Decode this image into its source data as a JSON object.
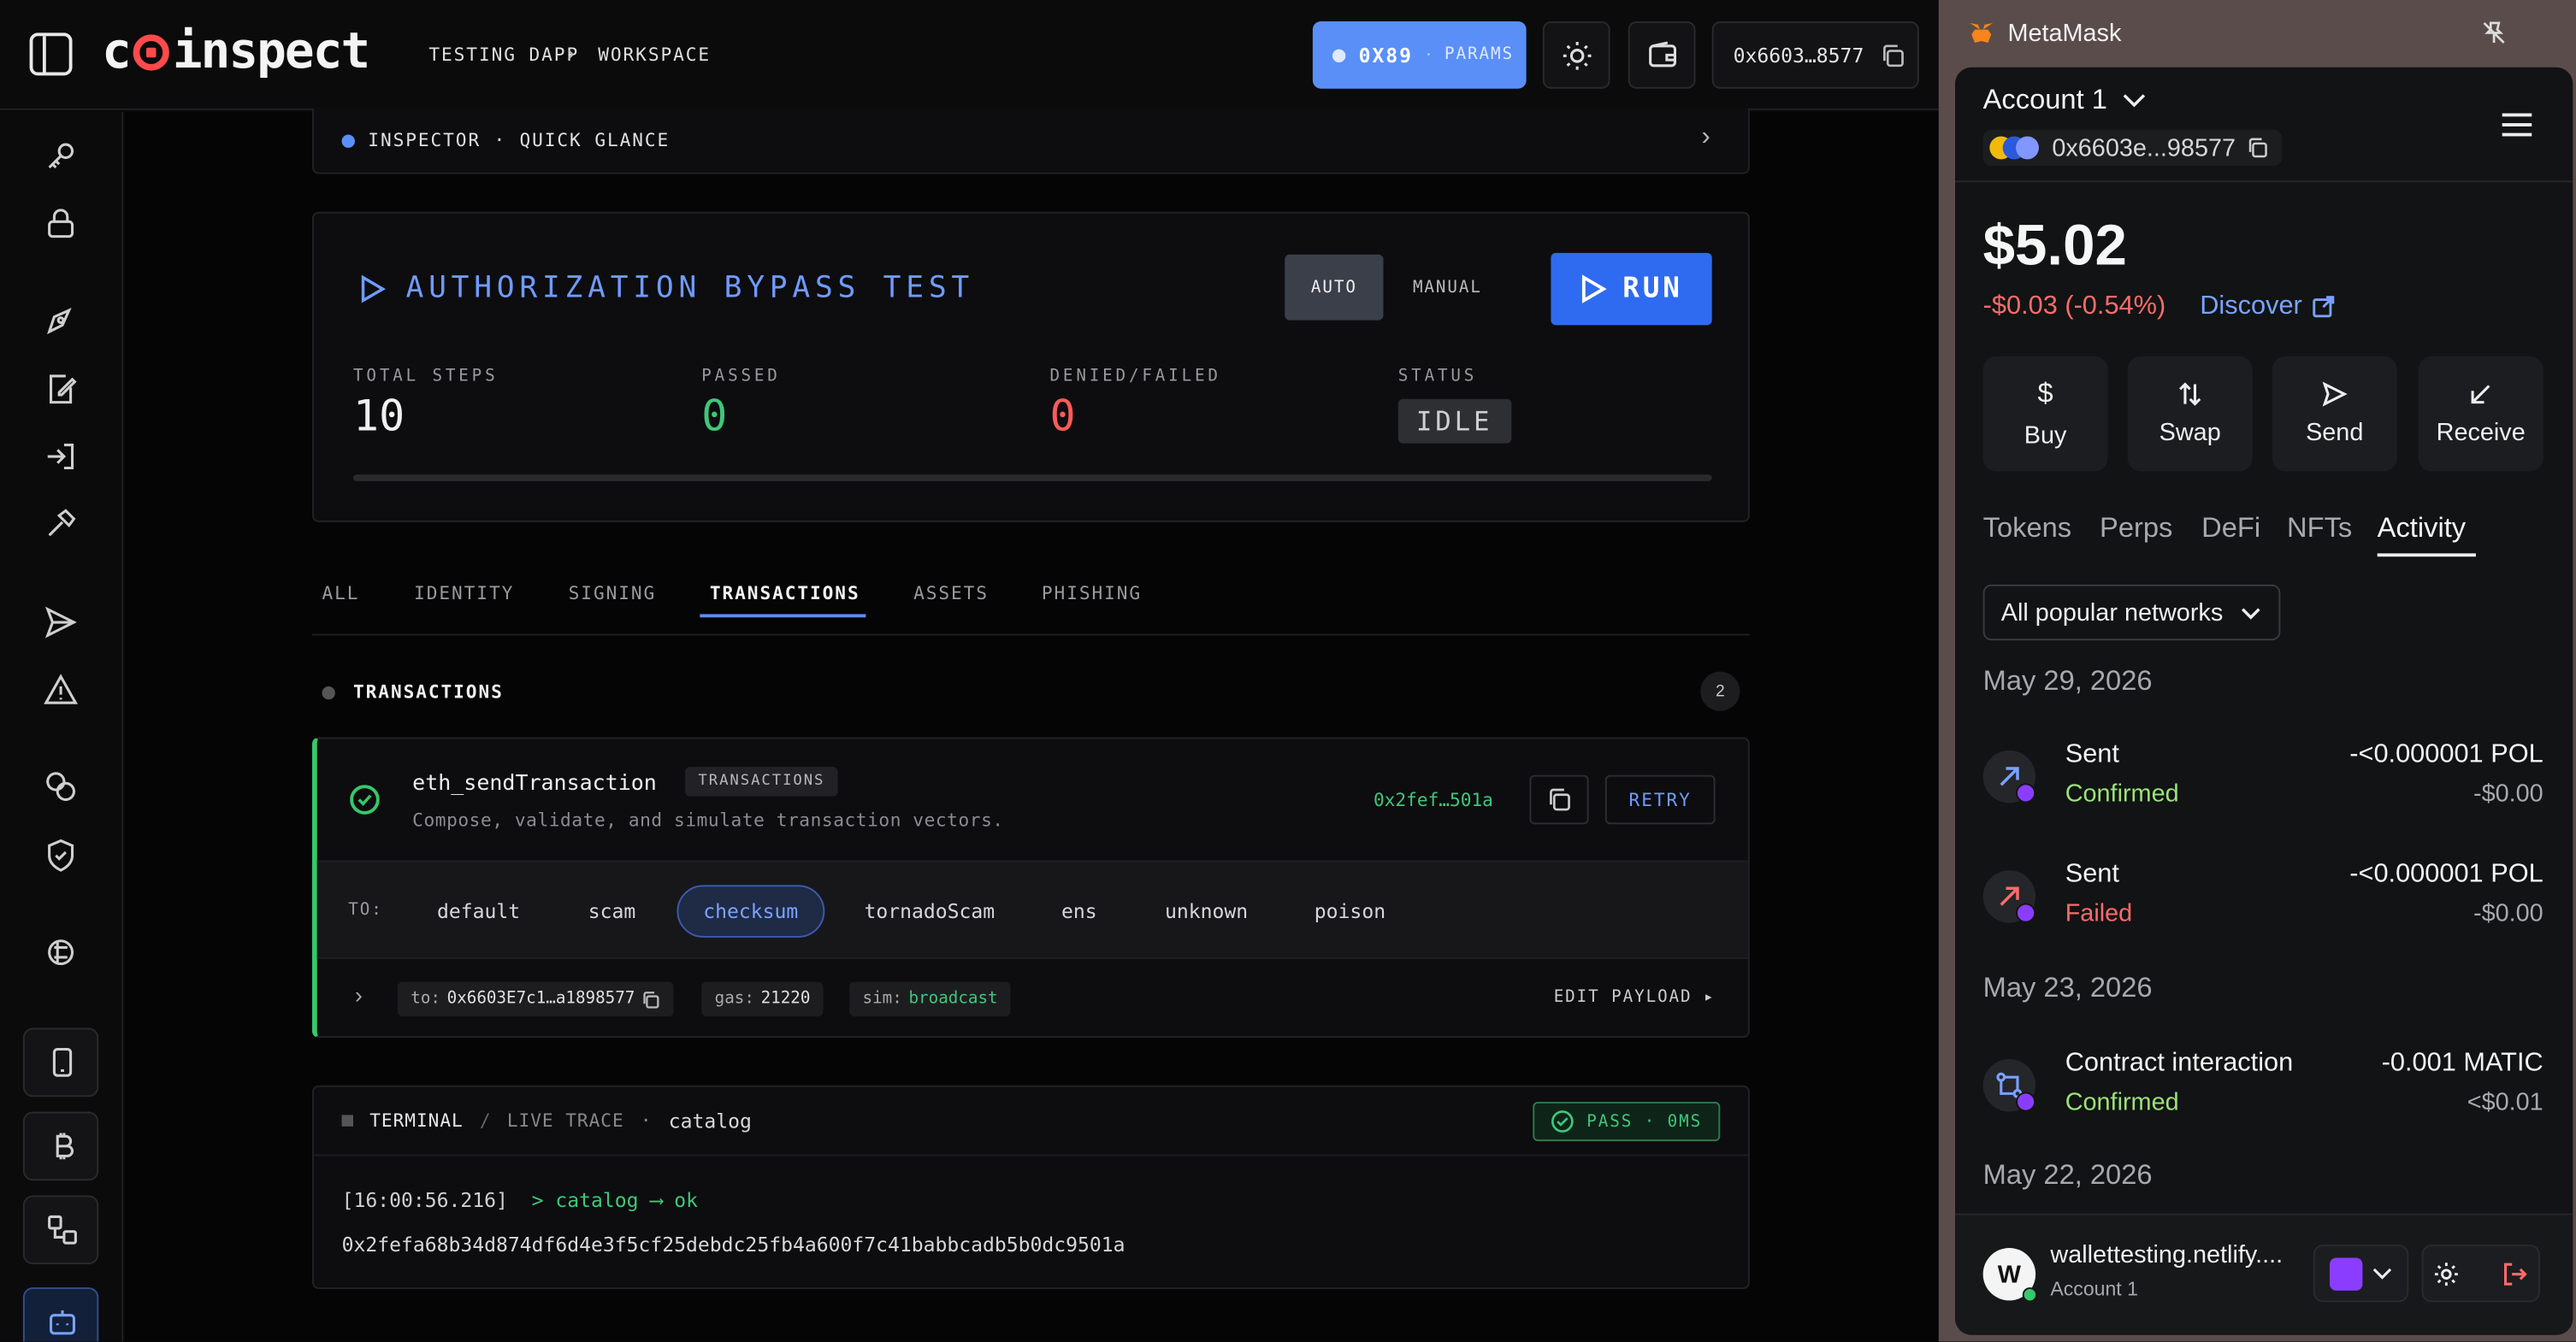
{
  "app": {
    "logo_text_pre": "c",
    "logo_text_post": "inspect",
    "breadcrumb": [
      "TESTING DAPP",
      "WORKSPACE"
    ],
    "chain": {
      "id": "0X89",
      "sep": "·",
      "params_label": "PARAMS"
    },
    "account_short": "0x6603…8577"
  },
  "inspector": {
    "label": "INSPECTOR",
    "sep": "·",
    "sub": "QUICK GLANCE"
  },
  "test": {
    "title": "AUTHORIZATION BYPASS TEST",
    "mode_auto": "AUTO",
    "mode_manual": "MANUAL",
    "run_label": "RUN",
    "stats": [
      {
        "label": "TOTAL STEPS",
        "value": "10",
        "color": "#f0f0f0"
      },
      {
        "label": "PASSED",
        "value": "0",
        "color": "#3fc77a"
      },
      {
        "label": "DENIED/FAILED",
        "value": "0",
        "color": "#ff5a5a"
      }
    ],
    "status_label": "STATUS",
    "status_value": "IDLE",
    "progress_fraction": 0
  },
  "tabs": [
    "ALL",
    "IDENTITY",
    "SIGNING",
    "TRANSACTIONS",
    "ASSETS",
    "PHISHING"
  ],
  "active_tab": "TRANSACTIONS",
  "section": {
    "title": "TRANSACTIONS",
    "count": "2"
  },
  "tx": {
    "name": "eth_sendTransaction",
    "tag": "TRANSACTIONS",
    "desc": "Compose, validate, and simulate transaction vectors.",
    "hash": "0x2fef…501a",
    "retry_label": "RETRY",
    "to_label": "TO:",
    "to_options": [
      "default",
      "scam",
      "checksum",
      "tornadoScam",
      "ens",
      "unknown",
      "poison"
    ],
    "to_selected": "checksum",
    "to_value_prefix": "to:",
    "to_value": "0x6603E7c1…a1898577",
    "gas_label": "gas:",
    "gas_value": "21220",
    "sim_label": "sim:",
    "sim_value": "broadcast",
    "edit_label": "EDIT PAYLOAD ▸"
  },
  "terminal": {
    "title": "TERMINAL",
    "slash": "/",
    "sub": "LIVE TRACE",
    "dot": "·",
    "name": "catalog",
    "badge": "PASS · 0MS",
    "ts": "[16:00:56.216]",
    "cmd": "> catalog ⟶ ok",
    "hash": "0x2fefa68b34d874df6d4e3f5cf25debdc25fb4a600f7c41babbcadb5b0dc9501a"
  },
  "metamask": {
    "window_title": "MetaMask",
    "account_name": "Account 1",
    "address": "0x6603e...98577",
    "balance": "$5.02",
    "change": "-$0.03 (-0.54%)",
    "discover": "Discover",
    "actions": [
      "Buy",
      "Swap",
      "Send",
      "Receive"
    ],
    "tabs": [
      "Tokens",
      "Perps",
      "DeFi",
      "NFTs",
      "Activity"
    ],
    "active_tab": "Activity",
    "network_filter": "All popular networks",
    "dates": [
      "May 29, 2026",
      "May 23, 2026",
      "May 22, 2026"
    ],
    "activity": [
      {
        "title": "Sent",
        "status": "Confirmed",
        "status_color": "#9be27a",
        "amount": "-<0.000001 POL",
        "fiat": "-$0.00",
        "kind": "sent-ok"
      },
      {
        "title": "Sent",
        "status": "Failed",
        "status_color": "#ff6b6b",
        "amount": "-<0.000001 POL",
        "fiat": "-$0.00",
        "kind": "sent-fail"
      },
      {
        "title": "Contract interaction",
        "status": "Confirmed",
        "status_color": "#9be27a",
        "amount": "-0.001 MATIC",
        "fiat": "<$0.01",
        "kind": "contract"
      }
    ],
    "site": "wallettesting.netlify....",
    "site_account": "Account 1"
  }
}
